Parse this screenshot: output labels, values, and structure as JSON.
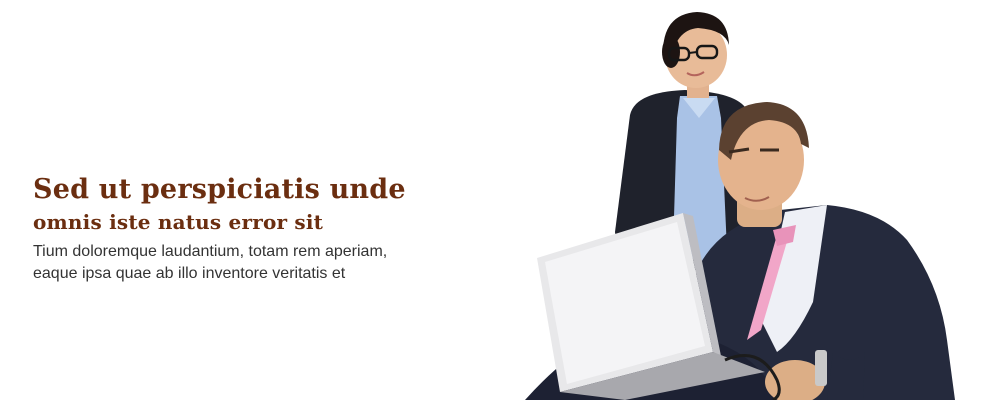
{
  "hero": {
    "headline": "Sed ut perspiciatis unde",
    "subheadline": "omnis iste natus error sit",
    "body_line_1": "Tium doloremque laudantium, totam rem aperiam,",
    "body_line_2": "eaque ipsa quae ab illo inventore veritatis et",
    "accent_color": "#6b2e10",
    "text_color": "#333333"
  },
  "photo": {
    "subject": "business-people-with-laptop-photo"
  }
}
